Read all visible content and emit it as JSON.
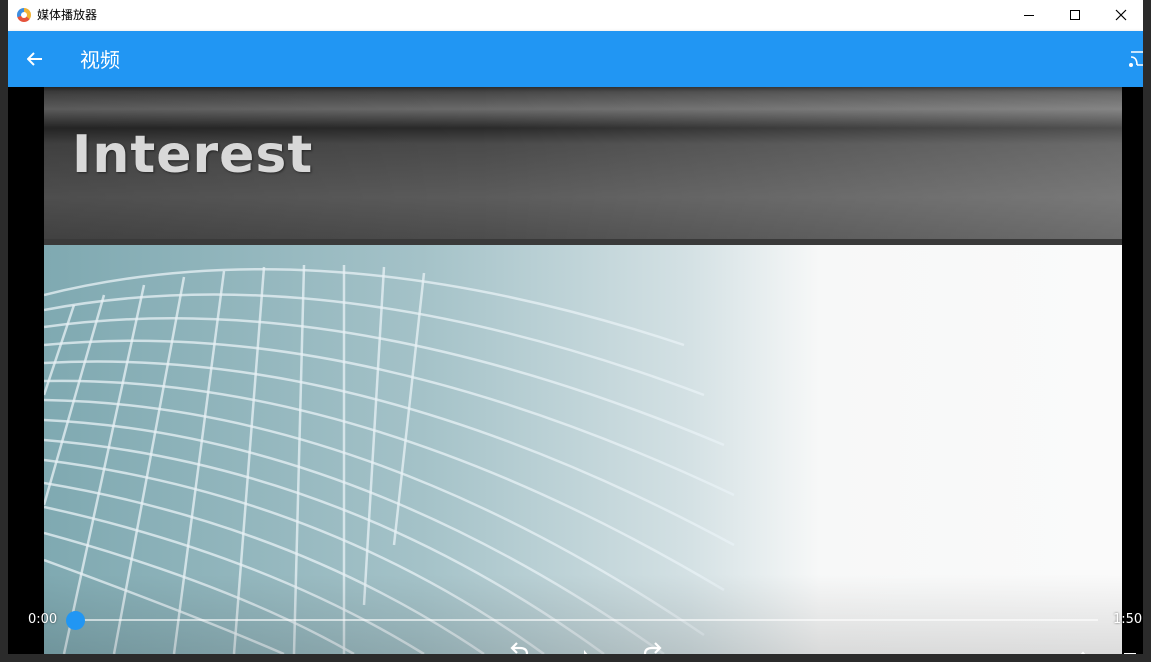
{
  "window": {
    "title": "媒体播放器",
    "icon": "media-player-app-icon",
    "controls": [
      "minimize-icon",
      "maximize-icon",
      "close-icon"
    ]
  },
  "appbar": {
    "title": "视频",
    "back_icon": "arrow-back-icon",
    "cast_icon": "cast-icon",
    "color": "#2196f3"
  },
  "video": {
    "frame_heading": "Interest"
  },
  "player": {
    "current_time": "0:00",
    "total_time": "1:50",
    "progress": 0,
    "accent": "#2196f3",
    "controls": [
      "replay-icon",
      "play-icon",
      "forward-icon",
      "speed-icon",
      "fullscreen-icon"
    ]
  }
}
